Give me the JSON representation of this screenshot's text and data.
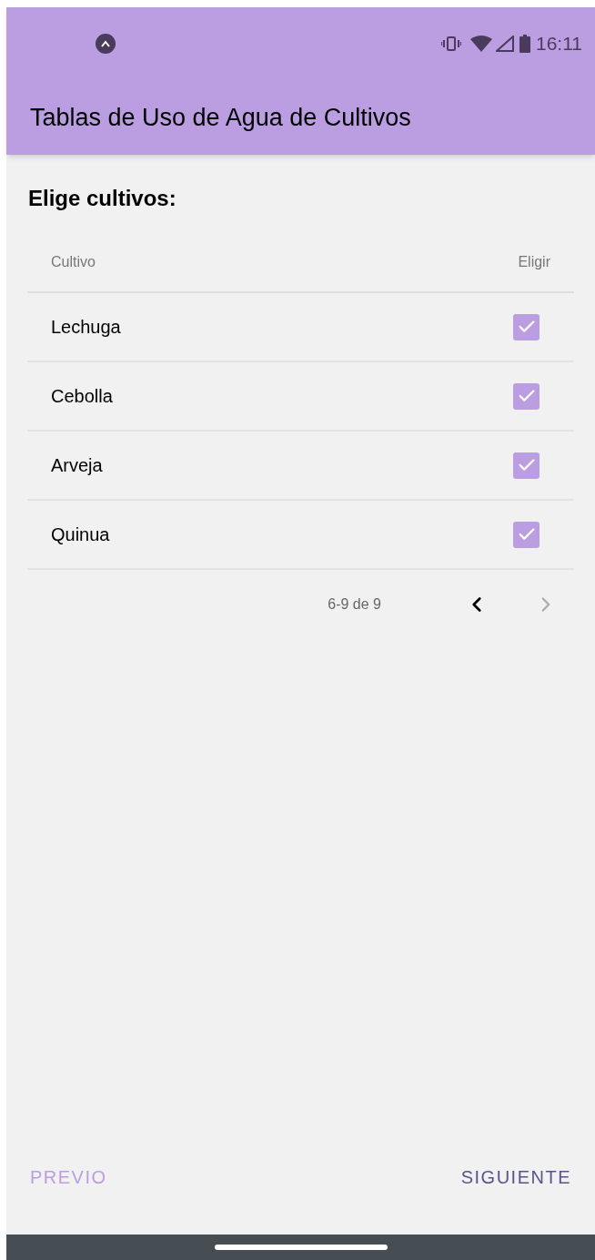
{
  "status_bar": {
    "time": "16:11"
  },
  "app_bar": {
    "title": "Tablas de Uso de Agua de Cultivos"
  },
  "heading": "Elige cultivos:",
  "table": {
    "columns": [
      "Cultivo",
      "Eligir"
    ],
    "rows": [
      {
        "name": "Lechuga",
        "checked": true
      },
      {
        "name": "Cebolla",
        "checked": true
      },
      {
        "name": "Arveja",
        "checked": true
      },
      {
        "name": "Quinua",
        "checked": true
      }
    ]
  },
  "pagination": {
    "range": "6-9 de 9",
    "previous_disabled": false,
    "next_disabled": true
  },
  "buttons": [
    {
      "label": "PREVIO",
      "disabled": true
    },
    {
      "label": "SIGUIENTE",
      "disabled": false
    }
  ]
}
